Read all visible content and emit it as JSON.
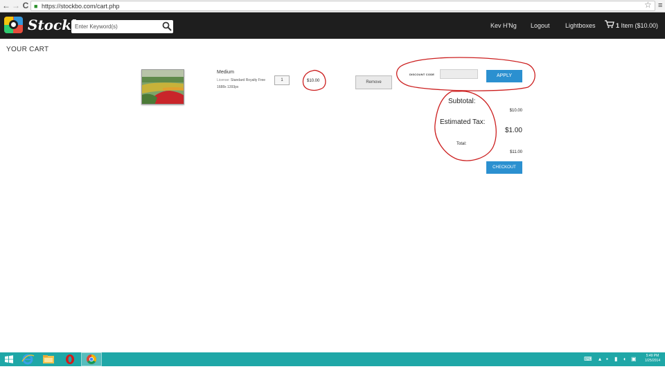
{
  "browser": {
    "url": "https://stockbo.com/cart.php",
    "back_glyph": "←",
    "forward_glyph": "→",
    "reload_glyph": "C",
    "star_glyph": "☆",
    "menu_glyph": "≡"
  },
  "header": {
    "logo_text": "Stockbo",
    "search_placeholder": "Enter Keyword(s)",
    "nav": {
      "user": "Kev H'Ng",
      "logout": "Logout",
      "lightboxes": "Lightboxes"
    },
    "cart_count": "1",
    "cart_text": "Item ($10.00)"
  },
  "page": {
    "title": "YOUR CART"
  },
  "cart_item": {
    "size": "Medium",
    "license_label": "License:",
    "license_value": "Standard Royalty Free",
    "dimensions": "1688x 1393px",
    "quantity": "1",
    "price": "$10.00",
    "remove_label": "Remove"
  },
  "discount": {
    "label": "DISCOUNT CODE",
    "value": "",
    "apply_label": "APPLY"
  },
  "summary": {
    "subtotal_label": "Subtotal:",
    "subtotal_value": "$10.00",
    "tax_label": "Estimated Tax:",
    "tax_value": "$1.00",
    "total_label": "Total:",
    "total_value": "$11.00",
    "checkout_label": "CHECKOUT"
  },
  "taskbar": {
    "apps": [
      "windows-start",
      "internet-explorer",
      "file-explorer",
      "opera",
      "chrome"
    ],
    "time": "5:49 PM",
    "date": "1/25/2014",
    "colors": {
      "bar": "#1fa7a7"
    }
  },
  "colors": {
    "header_bg": "#1e1e1e",
    "accent_button": "#2b90d0",
    "annotation_red": "#cc1f1f"
  }
}
